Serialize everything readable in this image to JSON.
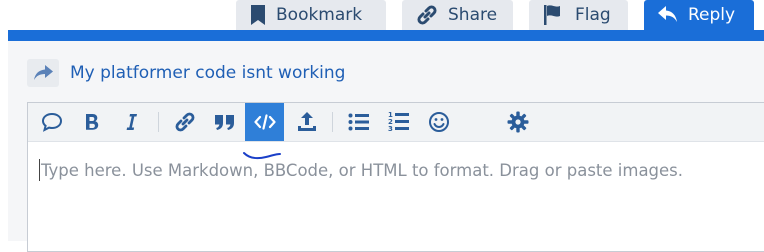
{
  "actions": {
    "bookmark": "Bookmark",
    "share": "Share",
    "flag": "Flag",
    "reply": "Reply"
  },
  "reply_to": {
    "title": "My platformer code isnt working"
  },
  "editor": {
    "placeholder": "Type here. Use Markdown, BBCode, or HTML to format. Drag or paste images.",
    "toolbar": [
      "speech-bubble-icon",
      "bold-icon",
      "italic-icon",
      "link-icon",
      "quote-icon",
      "code-icon",
      "upload-icon",
      "bulleted-list-icon",
      "numbered-list-icon",
      "emoji-icon",
      "settings-gear-icon"
    ],
    "active_tool": "code-icon"
  },
  "colors": {
    "accent": "#1a6ed8",
    "icon": "#2b5d9a",
    "link": "#1f5fb5",
    "placeholder": "#8a919b"
  }
}
